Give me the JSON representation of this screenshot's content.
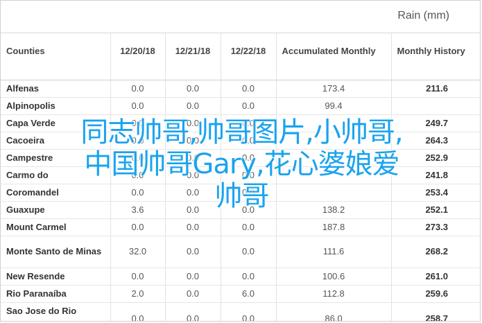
{
  "header": {
    "title": "Rain (mm)"
  },
  "table": {
    "columns": [
      "Counties",
      "12/20/18",
      "12/21/18",
      "12/22/18",
      "Accumulated Monthly",
      "Monthly History"
    ],
    "rows": [
      {
        "name": "Alfenas",
        "d1": "0.0",
        "d2": "0.0",
        "d3": "0.0",
        "acc": "173.4",
        "hist": "211.6"
      },
      {
        "name": "Alpinopolis",
        "d1": "0.0",
        "d2": "0.0",
        "d3": "0.0",
        "acc": "99.4",
        "hist": ""
      },
      {
        "name": "Capa Verde",
        "d1": "0.0",
        "d2": "0.0",
        "d3": "0.0",
        "acc": "",
        "hist": "249.7"
      },
      {
        "name": "Cacoeira",
        "d1": "0.0",
        "d2": "0.0",
        "d3": "0.0",
        "acc": "",
        "hist": "264.3"
      },
      {
        "name": "Campestre",
        "d1": "0.0",
        "d2": "0.0",
        "d3": "0.0",
        "acc": "",
        "hist": "252.9"
      },
      {
        "name": "Carmo do",
        "d1": "0.0",
        "d2": "0.0",
        "d3": "0.0",
        "acc": "",
        "hist": "241.8"
      },
      {
        "name": "Coromandel",
        "d1": "0.0",
        "d2": "0.0",
        "d3": "0.0",
        "acc": "",
        "hist": "253.4"
      },
      {
        "name": "Guaxupe",
        "d1": "3.6",
        "d2": "0.0",
        "d3": "0.0",
        "acc": "138.2",
        "hist": "252.1"
      },
      {
        "name": "Mount Carmel",
        "d1": "0.0",
        "d2": "0.0",
        "d3": "0.0",
        "acc": "187.8",
        "hist": "273.3"
      },
      {
        "name": "Monte Santo de Minas",
        "d1": "32.0",
        "d2": "0.0",
        "d3": "0.0",
        "acc": "111.6",
        "hist": "268.2"
      },
      {
        "name": "New Resende",
        "d1": "0.0",
        "d2": "0.0",
        "d3": "0.0",
        "acc": "100.6",
        "hist": "261.0"
      },
      {
        "name": "Rio Paranaíba",
        "d1": "2.0",
        "d2": "0.0",
        "d3": "6.0",
        "acc": "112.8",
        "hist": "259.6"
      },
      {
        "name": "Sao Jose do Rio Pardo",
        "d1": "0.0",
        "d2": "0.0",
        "d3": "0.0",
        "acc": "86.0",
        "hist": "258.7"
      }
    ]
  },
  "overlay": {
    "lines": [
      "同志帅哥,帅哥图片,小帅哥,",
      "中国帅哥Gary,花心婆娘爱",
      "帅哥"
    ],
    "color": "#1aa3ee"
  }
}
